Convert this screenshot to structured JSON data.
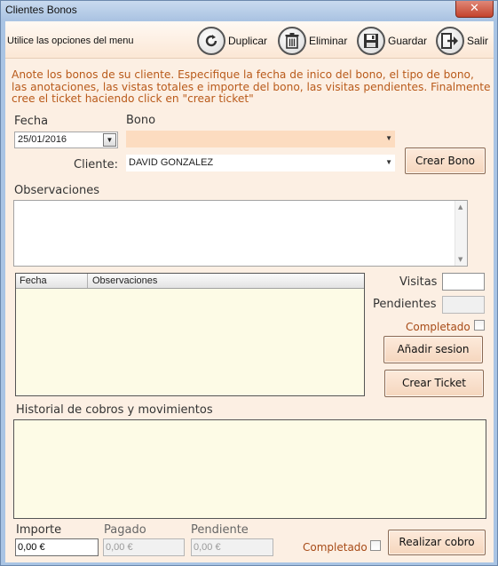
{
  "window": {
    "title": "Clientes Bonos",
    "close_label": "✕"
  },
  "toolbar": {
    "label": "Utilice las opciones del menu",
    "buttons": [
      {
        "label": "Duplicar",
        "icon": "refresh-icon"
      },
      {
        "label": "Eliminar",
        "icon": "trash-icon"
      },
      {
        "label": "Guardar",
        "icon": "floppy-icon"
      },
      {
        "label": "Salir",
        "icon": "exit-icon"
      }
    ]
  },
  "instructions": "Anote los bonos de su cliente. Especifique la fecha de inico del bono, el tipo de bono, las anotaciones, las vistas totales e importe del bono, las visitas pendientes. Finalmente cree el ticket haciendo click en \"crear ticket\"",
  "form": {
    "fecha_label": "Fecha",
    "fecha_value": "25/01/2016",
    "bono_label": "Bono",
    "bono_value": "",
    "cliente_label": "Cliente:",
    "cliente_value": "DAVID GONZALEZ",
    "crear_bono_label": "Crear Bono",
    "observaciones_label": "Observaciones",
    "observaciones_value": ""
  },
  "sessions": {
    "columns": [
      "Fecha",
      "Observaciones"
    ],
    "rows": [],
    "visitas_label": "Visitas",
    "visitas_value": "",
    "pendientes_label": "Pendientes",
    "pendientes_value": "",
    "completado_label": "Completado",
    "completado_checked": false,
    "anadir_sesion_label": "Añadir sesion",
    "crear_ticket_label": "Crear Ticket"
  },
  "history": {
    "label": "Historial de cobros y movimientos"
  },
  "payment": {
    "importe_label": "Importe",
    "importe_value": "0,00 €",
    "pagado_label": "Pagado",
    "pagado_value": "0,00 €",
    "pendiente_label": "Pendiente",
    "pendiente_value": "0,00 €",
    "completado_label": "Completado",
    "completado_checked": false,
    "realizar_cobro_label": "Realizar cobro"
  }
}
